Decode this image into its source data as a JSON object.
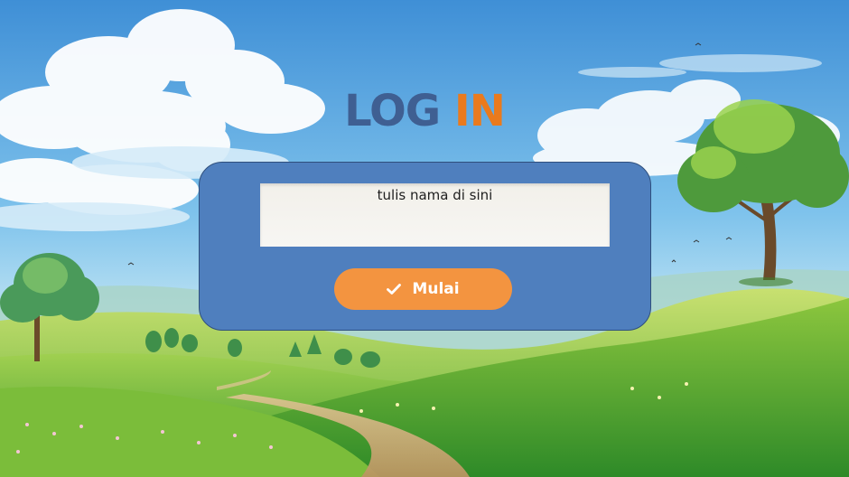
{
  "title": {
    "word1": "LOG",
    "word2": "IN"
  },
  "form": {
    "name_placeholder": "tulis nama di sini",
    "name_value": ""
  },
  "start_button": {
    "label": "Mulai",
    "icon": "check-icon"
  },
  "colors": {
    "title_log": "#3f5f92",
    "title_in": "#ea7a1d",
    "card": "#4f7fbe",
    "button": "#f39440"
  }
}
